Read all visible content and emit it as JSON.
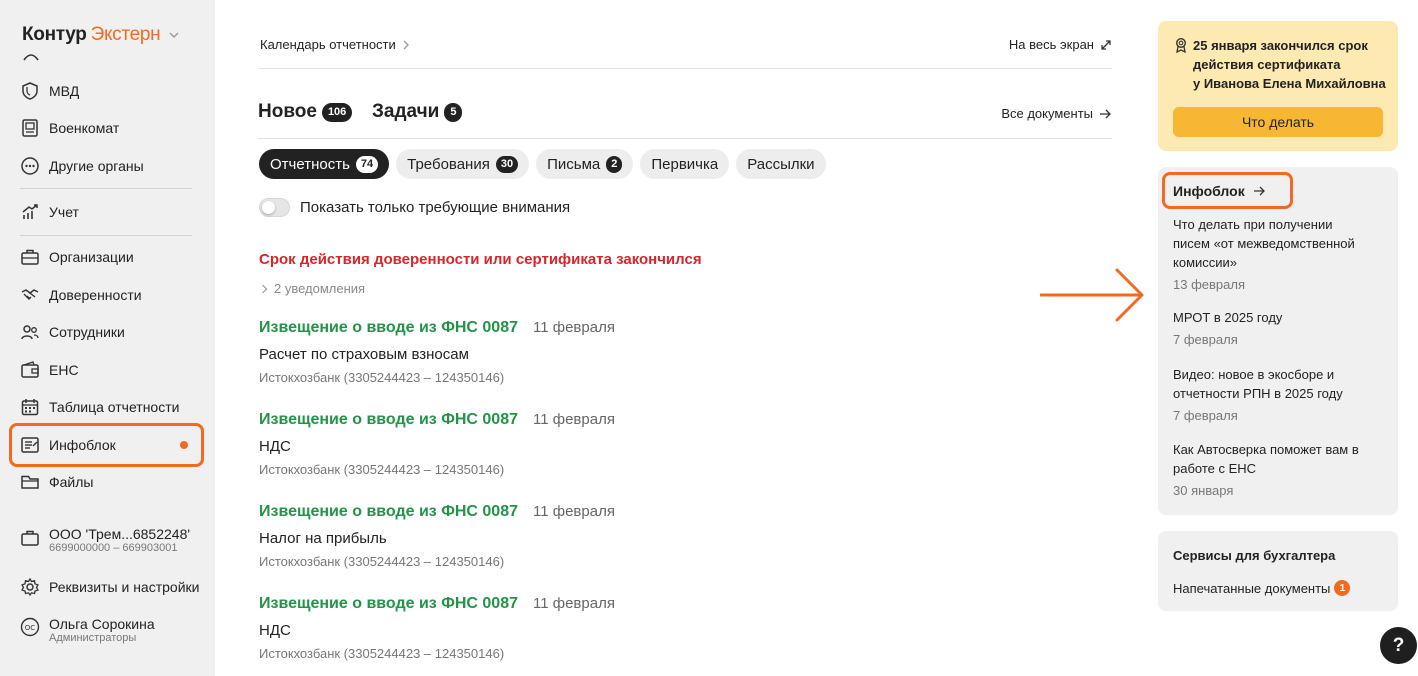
{
  "app": {
    "logo_part1": "Контур",
    "logo_part2": "Экстерн"
  },
  "sidebar": {
    "items": [
      {
        "label": "МВД",
        "icon": "shield-icon"
      },
      {
        "label": "Военкомат",
        "icon": "id-card-icon"
      },
      {
        "label": "Другие органы",
        "icon": "more-circle-icon"
      },
      {
        "label": "Учет",
        "icon": "chart-icon"
      },
      {
        "label": "Организации",
        "icon": "briefcase-icon"
      },
      {
        "label": "Доверенности",
        "icon": "handshake-icon"
      },
      {
        "label": "Сотрудники",
        "icon": "people-icon"
      },
      {
        "label": "ЕНС",
        "icon": "wallet-icon"
      },
      {
        "label": "Таблица отчетности",
        "icon": "calendar-icon"
      },
      {
        "label": "Инфоблок",
        "icon": "news-icon",
        "active": true
      },
      {
        "label": "Файлы",
        "icon": "folder-icon"
      }
    ],
    "org": {
      "name": "ООО 'Трем...6852248'",
      "ids": "6699000000 – 669903001"
    },
    "settings_label": "Реквизиты и настройки",
    "user": {
      "initials": "ОС",
      "name": "Ольга Сорокина",
      "role": "Администраторы"
    }
  },
  "topbar": {
    "breadcrumb": "Календарь отчетности",
    "fullscreen": "На весь экран"
  },
  "tabs": {
    "items": [
      {
        "label": "Новое",
        "count": "106"
      },
      {
        "label": "Задачи",
        "count": "5"
      }
    ],
    "all_docs": "Все документы"
  },
  "chips": [
    {
      "label": "Отчетность",
      "count": "74",
      "active": true
    },
    {
      "label": "Требования",
      "count": "30"
    },
    {
      "label": "Письма",
      "count": "2"
    },
    {
      "label": "Первичка",
      "count": ""
    },
    {
      "label": "Рассылки",
      "count": ""
    }
  ],
  "filter": {
    "toggle_label": "Показать только требующие внимания"
  },
  "alert": {
    "title": "Срок действия доверенности или сертификата закончился",
    "notifications": "2 уведомления"
  },
  "entries": [
    {
      "title": "Извещение о вводе из ФНС 0087",
      "date": "11 февраля",
      "doc": "Расчет по страховым взносам",
      "org": "Истокхозбанк (3305244423 – 124350146)"
    },
    {
      "title": "Извещение о вводе из ФНС 0087",
      "date": "11 февраля",
      "doc": "НДС",
      "org": "Истокхозбанк (3305244423 – 124350146)"
    },
    {
      "title": "Извещение о вводе из ФНС 0087",
      "date": "11 февраля",
      "doc": "Налог на прибыль",
      "org": "Истокхозбанк (3305244423 – 124350146)"
    },
    {
      "title": "Извещение о вводе из ФНС 0087",
      "date": "11 февраля",
      "doc": "НДС",
      "org": "Истокхозбанк (3305244423 – 124350146)"
    }
  ],
  "cert_card": {
    "line1": "25 января закончился срок",
    "line2": "действия сертификата",
    "line3": "у Иванова Елена Михайловна",
    "button": "Что делать"
  },
  "infoblock": {
    "title": "Инфоблок",
    "items": [
      {
        "text": "Что делать при получении писем «от межведомственной комиссии»",
        "date": "13 февраля"
      },
      {
        "text": "МРОТ в 2025 году",
        "date": "7 февраля"
      },
      {
        "text": "Видео: новое в экосборе и отчетности РПН в 2025 году",
        "date": "7 февраля"
      },
      {
        "text": "Как Автосверка поможет вам в работе с ЕНС",
        "date": "30 января"
      }
    ]
  },
  "services": {
    "title": "Сервисы для бухгалтера",
    "item": "Напечатанные документы",
    "count": "1"
  },
  "help": "?",
  "colors": {
    "accent": "#f26a21",
    "green": "#239447",
    "red": "#d7262b",
    "warning_bg": "#fde9b2",
    "warning_btn": "#f7b733"
  }
}
